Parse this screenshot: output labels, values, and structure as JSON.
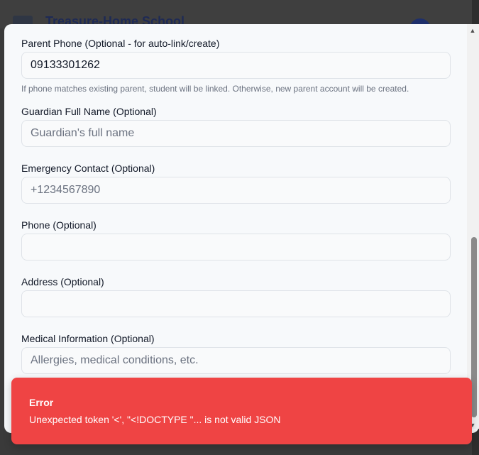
{
  "background": {
    "app_title": "Treasure-Home School"
  },
  "form": {
    "parent_phone": {
      "label": "Parent Phone (Optional - for auto-link/create)",
      "value": "09133301262",
      "help": "If phone matches existing parent, student will be linked. Otherwise, new parent account will be created."
    },
    "guardian_name": {
      "label": "Guardian Full Name (Optional)",
      "placeholder": "Guardian's full name"
    },
    "emergency_contact": {
      "label": "Emergency Contact (Optional)",
      "placeholder": "+1234567890"
    },
    "phone": {
      "label": "Phone (Optional)",
      "placeholder": ""
    },
    "address": {
      "label": "Address (Optional)",
      "placeholder": ""
    },
    "medical_info": {
      "label": "Medical Information (Optional)",
      "placeholder": "Allergies, medical conditions, etc."
    }
  },
  "toast": {
    "title": "Error",
    "message": "Unexpected token '<', \"<!DOCTYPE \"... is not valid JSON",
    "color": "#ef4444"
  },
  "scrollbar": {
    "up_arrow": "▲",
    "down_arrow": "▼"
  }
}
